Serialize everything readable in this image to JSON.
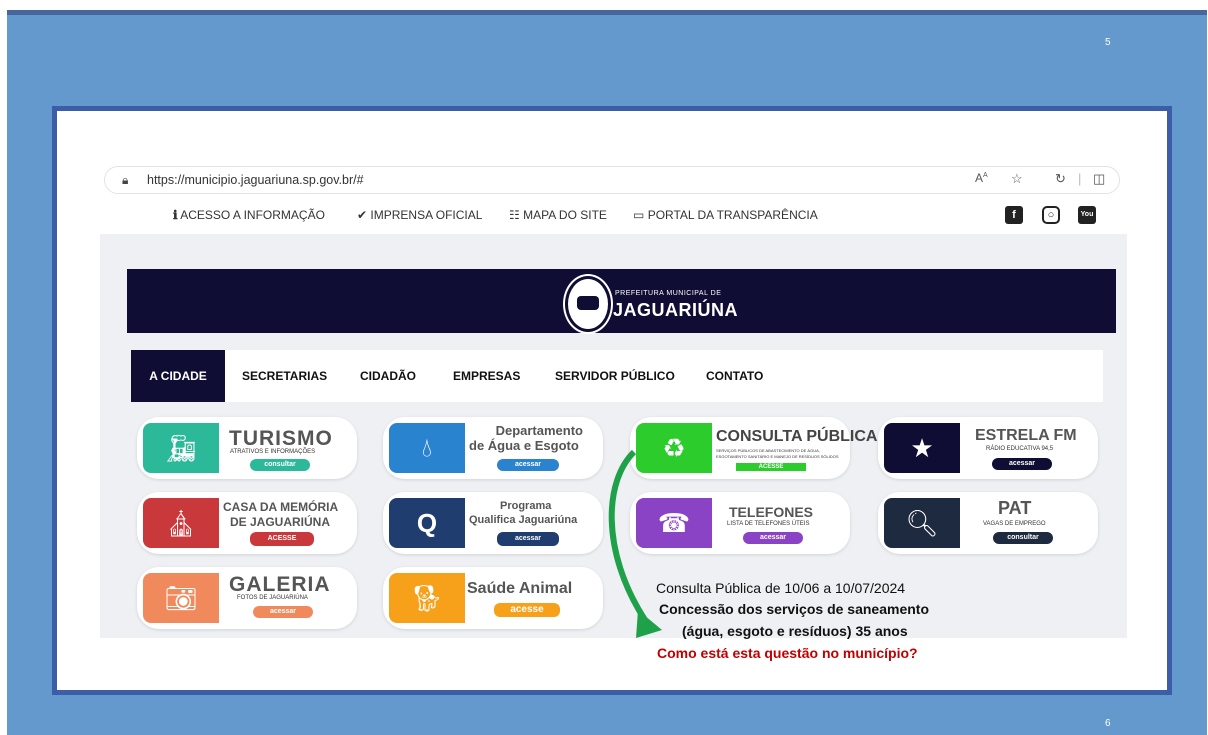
{
  "slide": {
    "page_top": "5",
    "page_bottom": "6"
  },
  "browser": {
    "url": "https://municipio.jaguariuna.sp.gov.br/#"
  },
  "topnav": {
    "items": [
      "ACESSO A INFORMAÇÃO",
      "IMPRENSA OFICIAL",
      "MAPA DO SITE",
      "PORTAL DA TRANSPARÊNCIA"
    ],
    "social": [
      "facebook-icon",
      "instagram-icon",
      "youtube-icon"
    ]
  },
  "banner": {
    "subtitle": "PREFEITURA MUNICIPAL DE",
    "title": "JAGUARIÚNA"
  },
  "menu": {
    "items": [
      "A CIDADE",
      "SECRETARIAS",
      "CIDADÃO",
      "EMPRESAS",
      "SERVIDOR PÚBLICO",
      "CONTATO"
    ]
  },
  "cards": {
    "turismo": {
      "title": "TURISMO",
      "sub": "ATRATIVOS E INFORMAÇÕES",
      "btn": "consultar"
    },
    "agua": {
      "title1": "Departamento",
      "title2": "de Água e Esgoto",
      "btn": "acessar"
    },
    "consulta": {
      "title": "CONSULTA PÚBLICA",
      "sub1": "SERVIÇOS PÚBLICOS DE ABASTECIMENTO DE ÁGUA,",
      "sub2": "ESGOTAMENTO SANITÁRIO E MANEJO DE RESÍDUOS SÓLIDOS",
      "btn": "ACESSE"
    },
    "estrela": {
      "title": "ESTRELA FM",
      "sub": "RÁDIO EDUCATIVA 94,5",
      "btn": "acessar"
    },
    "casa": {
      "title1": "CASA DA MEMÓRIA",
      "title2": "DE JAGUARIÚNA",
      "btn": "ACESSE"
    },
    "programa": {
      "title1": "Programa",
      "title2": "Qualifica Jaguariúna",
      "btn": "acessar"
    },
    "telefones": {
      "title": "TELEFONES",
      "sub": "LISTA DE TELEFONES ÚTEIS",
      "btn": "acessar"
    },
    "pat": {
      "title": "PAT",
      "sub": "VAGAS DE EMPREGO",
      "btn": "consultar"
    },
    "galeria": {
      "title": "GALERIA",
      "sub": "FOTOS DE JAGUARIÚNA",
      "btn": "acessar"
    },
    "saude": {
      "title": "Saúde Animal",
      "btn": "acesse"
    }
  },
  "annotation": {
    "line1": "Consulta Pública de 10/06 a 10/07/2024",
    "line2": "Concessão dos serviços de saneamento",
    "line3": "(água, esgoto e resíduos) 35 anos",
    "line4": "Como está esta questão no município?"
  },
  "colors": {
    "slide_bg": "#6399cc",
    "frame_border": "#3c5ea8",
    "navy": "#0f0d33",
    "annotation_red": "#c00000",
    "arrow_green": "#1fa14a"
  }
}
